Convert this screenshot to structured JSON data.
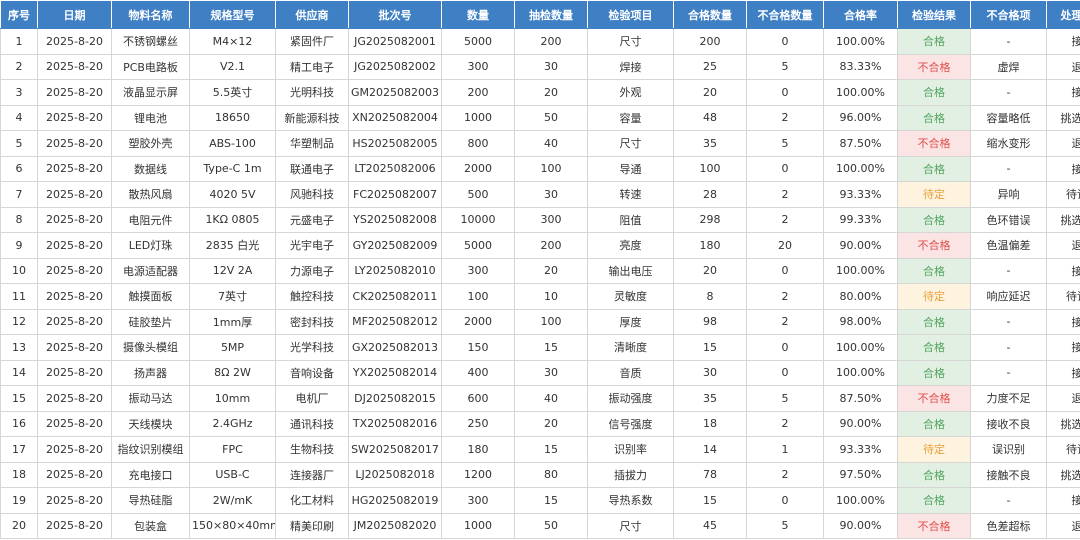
{
  "table": {
    "headers": [
      "序号",
      "日期",
      "物料名称",
      "规格型号",
      "供应商",
      "批次号",
      "数量",
      "抽检数量",
      "检验项目",
      "合格数量",
      "不合格数量",
      "合格率",
      "检验结果",
      "不合格项",
      "处理方式"
    ],
    "rows": [
      [
        "1",
        "2025-8-20",
        "不锈钢螺丝",
        "M4×12",
        "紧固件厂",
        "JG2025082001",
        "5000",
        "200",
        "尺寸",
        "200",
        "0",
        "100.00%",
        "合格",
        "-",
        "接收"
      ],
      [
        "2",
        "2025-8-20",
        "PCB电路板",
        "V2.1",
        "精工电子",
        "JG2025082002",
        "300",
        "30",
        "焊接",
        "25",
        "5",
        "83.33%",
        "不合格",
        "虚焊",
        "退货"
      ],
      [
        "3",
        "2025-8-20",
        "液晶显示屏",
        "5.5英寸",
        "光明科技",
        "GM2025082003",
        "200",
        "20",
        "外观",
        "20",
        "0",
        "100.00%",
        "合格",
        "-",
        "接收"
      ],
      [
        "4",
        "2025-8-20",
        "锂电池",
        "18650",
        "新能源科技",
        "XN2025082004",
        "1000",
        "50",
        "容量",
        "48",
        "2",
        "96.00%",
        "合格",
        "容量略低",
        "挑选使用"
      ],
      [
        "5",
        "2025-8-20",
        "塑胶外壳",
        "ABS-100",
        "华塑制品",
        "HS2025082005",
        "800",
        "40",
        "尺寸",
        "35",
        "5",
        "87.50%",
        "不合格",
        "缩水变形",
        "退货"
      ],
      [
        "6",
        "2025-8-20",
        "数据线",
        "Type-C 1m",
        "联通电子",
        "LT2025082006",
        "2000",
        "100",
        "导通",
        "100",
        "0",
        "100.00%",
        "合格",
        "-",
        "接收"
      ],
      [
        "7",
        "2025-8-20",
        "散热风扇",
        "4020 5V",
        "风驰科技",
        "FC2025082007",
        "500",
        "30",
        "转速",
        "28",
        "2",
        "93.33%",
        "待定",
        "异响",
        "待评审"
      ],
      [
        "8",
        "2025-8-20",
        "电阻元件",
        "1KΩ 0805",
        "元盛电子",
        "YS2025082008",
        "10000",
        "300",
        "阻值",
        "298",
        "2",
        "99.33%",
        "合格",
        "色环错误",
        "挑选使用"
      ],
      [
        "9",
        "2025-8-20",
        "LED灯珠",
        "2835 白光",
        "光宇电子",
        "GY2025082009",
        "5000",
        "200",
        "亮度",
        "180",
        "20",
        "90.00%",
        "不合格",
        "色温偏差",
        "退货"
      ],
      [
        "10",
        "2025-8-20",
        "电源适配器",
        "12V 2A",
        "力源电子",
        "LY2025082010",
        "300",
        "20",
        "输出电压",
        "20",
        "0",
        "100.00%",
        "合格",
        "-",
        "接收"
      ],
      [
        "11",
        "2025-8-20",
        "触摸面板",
        "7英寸",
        "触控科技",
        "CK2025082011",
        "100",
        "10",
        "灵敏度",
        "8",
        "2",
        "80.00%",
        "待定",
        "响应延迟",
        "待评审"
      ],
      [
        "12",
        "2025-8-20",
        "硅胶垫片",
        "1mm厚",
        "密封科技",
        "MF2025082012",
        "2000",
        "100",
        "厚度",
        "98",
        "2",
        "98.00%",
        "合格",
        "-",
        "接收"
      ],
      [
        "13",
        "2025-8-20",
        "摄像头模组",
        "5MP",
        "光学科技",
        "GX2025082013",
        "150",
        "15",
        "清晰度",
        "15",
        "0",
        "100.00%",
        "合格",
        "-",
        "接收"
      ],
      [
        "14",
        "2025-8-20",
        "扬声器",
        "8Ω 2W",
        "音响设备",
        "YX2025082014",
        "400",
        "30",
        "音质",
        "30",
        "0",
        "100.00%",
        "合格",
        "-",
        "接收"
      ],
      [
        "15",
        "2025-8-20",
        "振动马达",
        "10mm",
        "电机厂",
        "DJ2025082015",
        "600",
        "40",
        "振动强度",
        "35",
        "5",
        "87.50%",
        "不合格",
        "力度不足",
        "退货"
      ],
      [
        "16",
        "2025-8-20",
        "天线模块",
        "2.4GHz",
        "通讯科技",
        "TX2025082016",
        "250",
        "20",
        "信号强度",
        "18",
        "2",
        "90.00%",
        "合格",
        "接收不良",
        "挑选使用"
      ],
      [
        "17",
        "2025-8-20",
        "指纹识别模组",
        "FPC",
        "生物科技",
        "SW2025082017",
        "180",
        "15",
        "识别率",
        "14",
        "1",
        "93.33%",
        "待定",
        "误识别",
        "待评审"
      ],
      [
        "18",
        "2025-8-20",
        "充电接口",
        "USB-C",
        "连接器厂",
        "LJ2025082018",
        "1200",
        "80",
        "插拔力",
        "78",
        "2",
        "97.50%",
        "合格",
        "接触不良",
        "挑选使用"
      ],
      [
        "19",
        "2025-8-20",
        "导热硅脂",
        "2W/mK",
        "化工材料",
        "HG2025082019",
        "300",
        "15",
        "导热系数",
        "15",
        "0",
        "100.00%",
        "合格",
        "-",
        "接收"
      ],
      [
        "20",
        "2025-8-20",
        "包装盒",
        "150×80×40mm",
        "精美印刷",
        "JM2025082020",
        "1000",
        "50",
        "尺寸",
        "45",
        "5",
        "90.00%",
        "不合格",
        "色差超标",
        "退货"
      ]
    ]
  },
  "result_colors": {
    "合格": {
      "bg": "#e2f0e4",
      "fg": "#52a45d"
    },
    "不合格": {
      "bg": "#fbe4e4",
      "fg": "#e0504f"
    },
    "待定": {
      "bg": "#fdf3df",
      "fg": "#e6a23c"
    }
  },
  "colors": {
    "header_bg": "#3f7fc4",
    "header_text": "#ffffff",
    "grid": "#d6d6d6"
  }
}
